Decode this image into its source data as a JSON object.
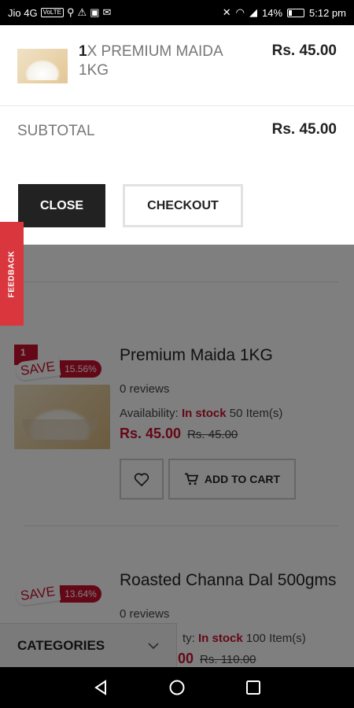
{
  "status_bar": {
    "carrier": "Jio 4G",
    "volte": "VoLTE",
    "battery": "14%",
    "time": "5:12 pm"
  },
  "cart": {
    "item": {
      "qty": "1",
      "name": "X PREMIUM MAIDA 1KG",
      "price": "Rs. 45.00"
    },
    "subtotal_label": "SUBTOTAL",
    "subtotal_value": "Rs. 45.00",
    "close_label": "CLOSE",
    "checkout_label": "CHECKOUT"
  },
  "feedback_label": "FEEDBACK",
  "products": [
    {
      "badge_number": "1",
      "save_word": "SAVE",
      "save_percent": "15.56%",
      "name": "Premium Maida 1KG",
      "reviews": "0 reviews",
      "availability_label": "Availability:",
      "stock_status": "In stock",
      "stock_count": "50 Item(s)",
      "price": "Rs. 45.00",
      "old_price": "Rs. 45.00",
      "add_to_cart_label": "ADD TO CART"
    },
    {
      "save_word": "SAVE",
      "save_percent": "13.64%",
      "name": "Roasted Channa Dal 500gms",
      "reviews": "0 reviews",
      "availability_label": "ty:",
      "stock_status": "In stock",
      "stock_count": "100 Item(s)",
      "price": "00",
      "old_price": "Rs. 110.00"
    }
  ],
  "categories_label": "CATEGORIES",
  "colors": {
    "accent": "#c8102e",
    "feedback": "#d9363e",
    "close_button": "#222222"
  }
}
